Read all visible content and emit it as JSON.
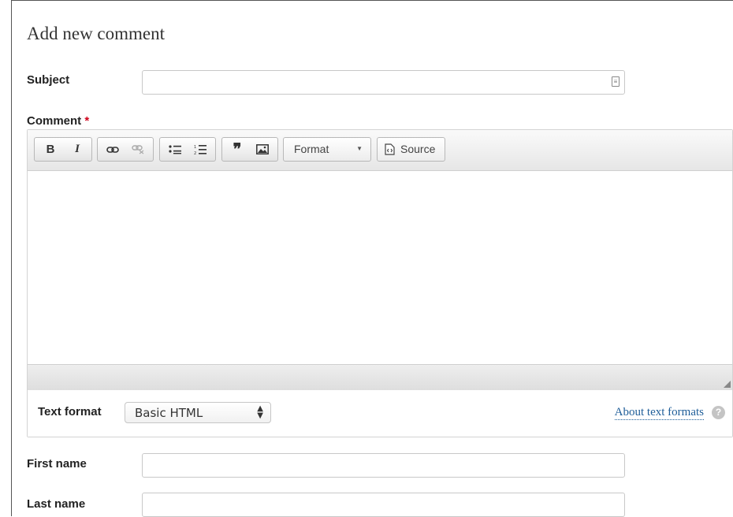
{
  "form": {
    "heading": "Add new comment",
    "subject_label": "Subject",
    "subject_value": "",
    "comment_label": "Comment",
    "required_marker": "*",
    "first_name_label": "First name",
    "first_name_value": "",
    "last_name_label": "Last name",
    "last_name_value": ""
  },
  "toolbar": {
    "bold_label": "B",
    "italic_label": "I",
    "format_label": "Format",
    "source_label": "Source"
  },
  "text_format": {
    "label": "Text format",
    "selected": "Basic HTML",
    "about_link": "About text formats",
    "help_glyph": "?"
  },
  "icons": [
    "link-icon",
    "unlink-icon",
    "bulleted-list-icon",
    "numbered-list-icon",
    "blockquote-icon",
    "image-icon",
    "source-icon",
    "dropdown-arrow-icon",
    "autofill-icon",
    "resize-handle-icon",
    "help-icon"
  ],
  "colors": {
    "required": "#d0021b",
    "link": "#1f5e99",
    "toolbar": "#e6e6e6"
  }
}
